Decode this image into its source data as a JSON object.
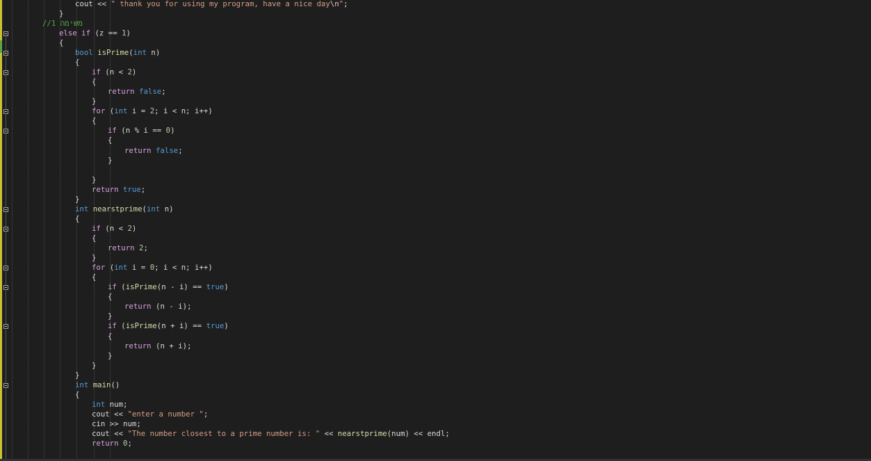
{
  "editor": {
    "colors": {
      "background": "#1e1e1e",
      "keyword": "#569cd6",
      "control": "#d8a0df",
      "string": "#d69d85",
      "number": "#b5cea8",
      "function": "#dcdcaa",
      "comment": "#57a64a",
      "changed_bar": "#c9c331"
    },
    "lines": [
      {
        "t": [
          [
            "d",
            "cout << "
          ],
          [
            "str",
            "\" thank you for using my program, have a nice day"
          ],
          [
            "esc",
            "\\n"
          ],
          [
            "str",
            "\""
          ],
          [
            "d",
            ";"
          ]
        ]
      },
      {
        "t": [
          [
            "d",
            "}"
          ]
        ]
      },
      {
        "t": [
          [
            "cmt",
            "//1 משימה"
          ]
        ]
      },
      {
        "t": [
          [
            "ctl",
            "else if"
          ],
          [
            "d",
            " (z == "
          ],
          [
            "num",
            "1"
          ],
          [
            "d",
            ")"
          ]
        ]
      },
      {
        "t": [
          [
            "d",
            "{"
          ]
        ]
      },
      {
        "t": [
          [
            "kw",
            "bool"
          ],
          [
            "d",
            " "
          ],
          [
            "fn",
            "isPrime"
          ],
          [
            "d",
            "("
          ],
          [
            "kw",
            "int"
          ],
          [
            "d",
            " n)"
          ]
        ]
      },
      {
        "t": [
          [
            "d",
            "{"
          ]
        ]
      },
      {
        "t": [
          [
            "ctl",
            "if"
          ],
          [
            "d",
            " (n < "
          ],
          [
            "num",
            "2"
          ],
          [
            "d",
            ")"
          ]
        ]
      },
      {
        "t": [
          [
            "d",
            "{"
          ]
        ]
      },
      {
        "t": [
          [
            "ctl",
            "return"
          ],
          [
            "d",
            " "
          ],
          [
            "kw",
            "false"
          ],
          [
            "d",
            ";"
          ]
        ]
      },
      {
        "t": [
          [
            "d",
            "}"
          ]
        ]
      },
      {
        "t": [
          [
            "ctl",
            "for"
          ],
          [
            "d",
            " ("
          ],
          [
            "kw",
            "int"
          ],
          [
            "d",
            " i = "
          ],
          [
            "num",
            "2"
          ],
          [
            "d",
            "; i < n; i++)"
          ]
        ]
      },
      {
        "t": [
          [
            "d",
            "{"
          ]
        ]
      },
      {
        "t": [
          [
            "ctl",
            "if"
          ],
          [
            "d",
            " (n % i == "
          ],
          [
            "num",
            "0"
          ],
          [
            "d",
            ")"
          ]
        ]
      },
      {
        "t": [
          [
            "d",
            "{"
          ]
        ]
      },
      {
        "t": [
          [
            "ctl",
            "return"
          ],
          [
            "d",
            " "
          ],
          [
            "kw",
            "false"
          ],
          [
            "d",
            ";"
          ]
        ]
      },
      {
        "t": [
          [
            "d",
            "}"
          ]
        ]
      },
      {
        "t": [
          [
            "d",
            ""
          ]
        ]
      },
      {
        "t": [
          [
            "d",
            "}"
          ]
        ]
      },
      {
        "t": [
          [
            "ctl",
            "return"
          ],
          [
            "d",
            " "
          ],
          [
            "kw",
            "true"
          ],
          [
            "d",
            ";"
          ]
        ]
      },
      {
        "t": [
          [
            "d",
            "}"
          ]
        ]
      },
      {
        "t": [
          [
            "kw",
            "int"
          ],
          [
            "d",
            " "
          ],
          [
            "fn",
            "nearstprime"
          ],
          [
            "d",
            "("
          ],
          [
            "kw",
            "int"
          ],
          [
            "d",
            " n)"
          ]
        ]
      },
      {
        "t": [
          [
            "d",
            "{"
          ]
        ]
      },
      {
        "t": [
          [
            "ctl",
            "if"
          ],
          [
            "d",
            " (n < "
          ],
          [
            "num",
            "2"
          ],
          [
            "d",
            ")"
          ]
        ]
      },
      {
        "t": [
          [
            "d",
            "{"
          ]
        ]
      },
      {
        "t": [
          [
            "ctl",
            "return"
          ],
          [
            "d",
            " "
          ],
          [
            "num",
            "2"
          ],
          [
            "d",
            ";"
          ]
        ]
      },
      {
        "t": [
          [
            "d",
            "}"
          ]
        ]
      },
      {
        "t": [
          [
            "ctl",
            "for"
          ],
          [
            "d",
            " ("
          ],
          [
            "kw",
            "int"
          ],
          [
            "d",
            " i = "
          ],
          [
            "num",
            "0"
          ],
          [
            "d",
            "; i < n; i++)"
          ]
        ]
      },
      {
        "t": [
          [
            "d",
            "{"
          ]
        ]
      },
      {
        "t": [
          [
            "ctl",
            "if"
          ],
          [
            "d",
            " ("
          ],
          [
            "fn",
            "isPrime"
          ],
          [
            "d",
            "(n - i) == "
          ],
          [
            "kw",
            "true"
          ],
          [
            "d",
            ")"
          ]
        ]
      },
      {
        "t": [
          [
            "d",
            "{"
          ]
        ]
      },
      {
        "t": [
          [
            "ctl",
            "return"
          ],
          [
            "d",
            " (n - i);"
          ]
        ]
      },
      {
        "t": [
          [
            "d",
            "}"
          ]
        ]
      },
      {
        "t": [
          [
            "ctl",
            "if"
          ],
          [
            "d",
            " ("
          ],
          [
            "fn",
            "isPrime"
          ],
          [
            "d",
            "(n + i) == "
          ],
          [
            "kw",
            "true"
          ],
          [
            "d",
            ")"
          ]
        ]
      },
      {
        "t": [
          [
            "d",
            "{"
          ]
        ]
      },
      {
        "t": [
          [
            "ctl",
            "return"
          ],
          [
            "d",
            " (n + i);"
          ]
        ]
      },
      {
        "t": [
          [
            "d",
            "}"
          ]
        ]
      },
      {
        "t": [
          [
            "d",
            "}"
          ]
        ]
      },
      {
        "t": [
          [
            "d",
            "}"
          ]
        ]
      },
      {
        "t": [
          [
            "kw",
            "int"
          ],
          [
            "d",
            " "
          ],
          [
            "fn",
            "main"
          ],
          [
            "d",
            "()"
          ]
        ]
      },
      {
        "t": [
          [
            "d",
            "{"
          ]
        ]
      },
      {
        "t": [
          [
            "kw",
            "int"
          ],
          [
            "d",
            " num;"
          ]
        ]
      },
      {
        "t": [
          [
            "d",
            "cout << "
          ],
          [
            "str",
            "\"enter a number \""
          ],
          [
            "d",
            ";"
          ]
        ]
      },
      {
        "t": [
          [
            "d",
            "cin >> num;"
          ]
        ]
      },
      {
        "t": [
          [
            "d",
            "cout << "
          ],
          [
            "str",
            "\"The number closest to a prime number is: \""
          ],
          [
            "d",
            " << "
          ],
          [
            "fn",
            "nearstprime"
          ],
          [
            "d",
            "(num) << endl;"
          ]
        ]
      },
      {
        "t": [
          [
            "ctl",
            "return"
          ],
          [
            "d",
            " "
          ],
          [
            "num",
            "0"
          ],
          [
            "d",
            ";"
          ]
        ]
      }
    ]
  }
}
